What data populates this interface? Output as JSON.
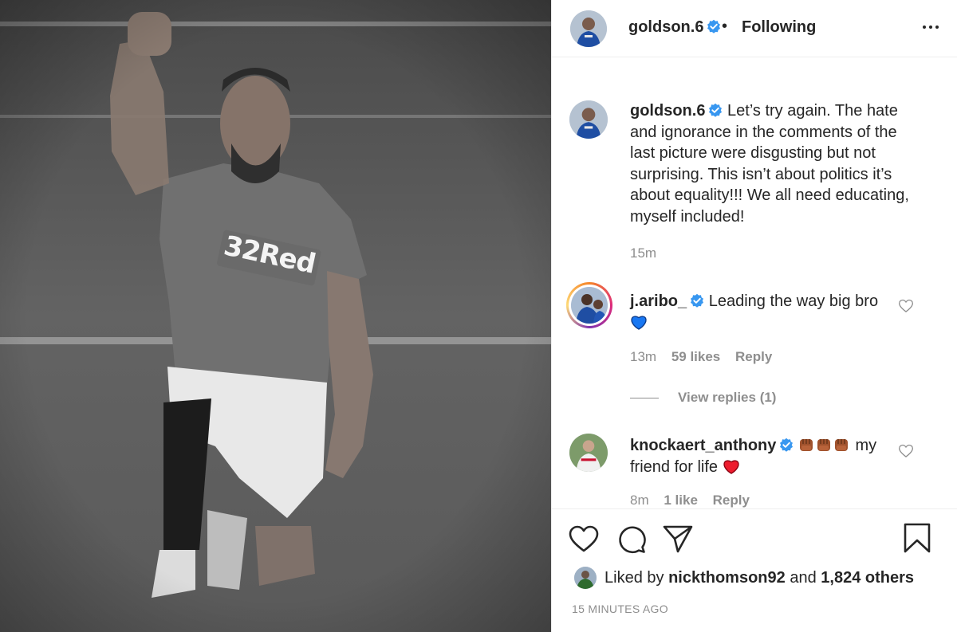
{
  "post_image": {
    "shirt_sponsor": "32Red"
  },
  "header": {
    "username": "goldson.6",
    "separator": "•",
    "follow_status": "Following"
  },
  "caption": {
    "username": "goldson.6",
    "text": "Let’s try again. The hate and ignorance in the comments of the last picture were disgusting but not surprising. This isn’t about politics it’s about equality!!! We all need educating, myself included!",
    "time": "15m"
  },
  "comments": [
    {
      "username": "j.aribo_",
      "text": "Leading the way big bro",
      "emoji": "blue-heart",
      "time": "13m",
      "likes": "59 likes",
      "reply_label": "Reply",
      "view_replies": "View replies (1)"
    },
    {
      "username": "knockaert_anthony",
      "emoji_prefix": "fist-x3",
      "text": "my friend for life",
      "emoji": "red-heart",
      "time": "8m",
      "likes": "1 like",
      "reply_label": "Reply"
    }
  ],
  "likes_summary": {
    "prefix": "Liked by",
    "user": "nickthomson92",
    "middle": "and",
    "count": "1,824 others"
  },
  "timestamp": "15 MINUTES AGO",
  "icons": {
    "like": "heart-outline-icon",
    "comment": "comment-bubble-icon",
    "share": "paper-plane-icon",
    "save": "bookmark-icon",
    "more": "ellipsis-icon",
    "verified": "verified-badge-icon"
  },
  "colors": {
    "text": "#262626",
    "secondary": "#8e8e8e",
    "verified": "#3897f0",
    "border": "#efefef",
    "red_heart": "#ed1c2e",
    "blue_heart": "#1877f2"
  }
}
